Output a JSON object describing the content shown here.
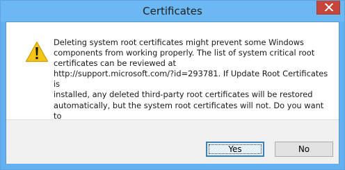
{
  "window": {
    "title": "Certificates"
  },
  "dialog": {
    "icon": "warning-icon",
    "message": "Deleting system root certificates might prevent some Windows\ncomponents from working properly. The list of system critical root\ncertificates can be reviewed at\nhttp://support.microsoft.com/?id=293781. If Update Root Certificates is\ninstalled, any deleted third-party root certificates will be restored\nautomatically, but the system root certificates will not. Do you want to\ndelete the selected certificate(s)?"
  },
  "buttons": {
    "yes_label": "Yes",
    "no_label": "No"
  },
  "colors": {
    "titlebar": "#6cb8f2",
    "close_button": "#c7463b",
    "warning_yellow": "#f5c518"
  }
}
